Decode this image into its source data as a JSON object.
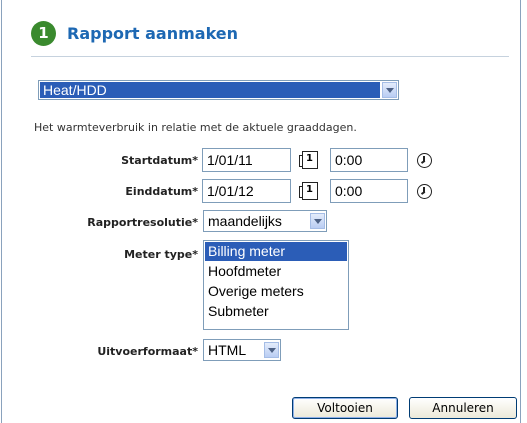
{
  "header": {
    "step": "1",
    "title": "Rapport aanmaken"
  },
  "report_type": {
    "selected": "Heat/HDD"
  },
  "description": "Het warmteverbruik in relatie met de aktuele graaddagen.",
  "form": {
    "start": {
      "label": "Startdatum*",
      "date": "1/01/11",
      "time": "0:00"
    },
    "end": {
      "label": "Einddatum*",
      "date": "1/01/12",
      "time": "0:00"
    },
    "resolution": {
      "label": "Rapportresolutie*",
      "selected": "maandelijks"
    },
    "meter_type": {
      "label": "Meter type*",
      "options": [
        "Billing meter",
        "Hoofdmeter",
        "Overige meters",
        "Submeter"
      ],
      "selected_index": 0
    },
    "output": {
      "label": "Uitvoerformaat*",
      "selected": "HTML"
    }
  },
  "calendar_icon_glyph": "1",
  "buttons": {
    "finish": "Voltooien",
    "cancel": "Annuleren"
  },
  "colors": {
    "title": "#1d68b3",
    "badge": "#3a8a2e",
    "selection": "#2b5db7"
  }
}
